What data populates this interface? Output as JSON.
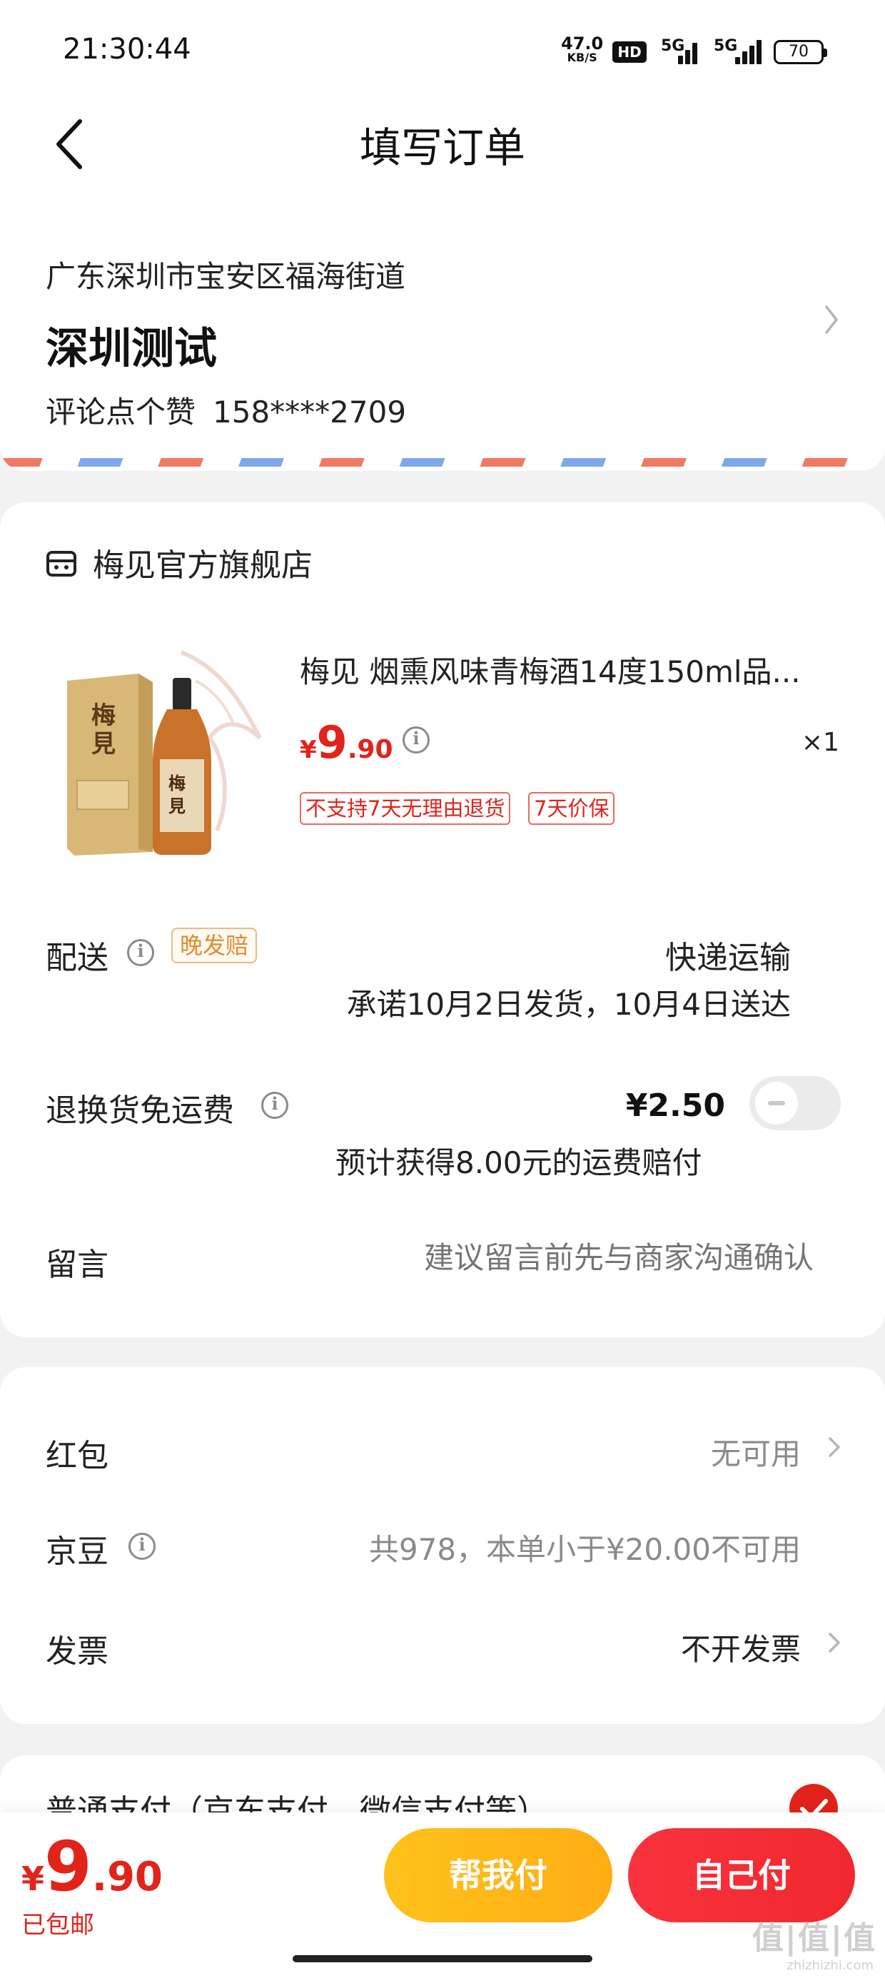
{
  "status_bar": {
    "time": "21:30:44",
    "net_speed": "47.0",
    "net_unit": "KB/S",
    "hd": "HD",
    "sig1": "5G",
    "sig2": "5G",
    "battery": "70"
  },
  "header": {
    "title": "填写订单"
  },
  "address": {
    "region": "广东深圳市宝安区福海街道",
    "name": "深圳测试",
    "contact_name": "评论点个赞",
    "phone": "158****2709"
  },
  "shop": {
    "name": "梅见官方旗舰店"
  },
  "product": {
    "title": "梅见 烟熏风味青梅酒14度150ml品...",
    "price_yen": "¥",
    "price_int": "9",
    "price_dec": ".90",
    "qty": "×1",
    "tags": [
      "不支持7天无理由退货",
      "7天价保"
    ],
    "image_icon": "liquor-bottle-with-box"
  },
  "delivery": {
    "label": "配送",
    "tag": "晚发赔",
    "mode": "快递运输",
    "promise": "承诺10月2日发货，10月4日送达"
  },
  "return_shipping": {
    "label": "退换货免运费",
    "price": "¥2.50",
    "compensate": "预计获得8.00元的运费赔付",
    "enabled": false
  },
  "message": {
    "label": "留言",
    "placeholder": "建议留言前先与商家沟通确认"
  },
  "benefits": {
    "red_packet_label": "红包",
    "red_packet_value": "无可用",
    "jd_beans_label": "京豆",
    "jd_beans_value": "共978，本单小于¥20.00不可用",
    "invoice_label": "发票",
    "invoice_value": "不开发票"
  },
  "payment": {
    "option_label": "普通支付（京东支付、微信支付等）",
    "selected": true
  },
  "bottom": {
    "total_yen": "¥",
    "total_int": "9",
    "total_dec": ".90",
    "free_shipping": "已包邮",
    "help_pay": "帮我付",
    "self_pay": "自己付"
  },
  "watermark": {
    "main": "值|值|值",
    "sub": "zhizhizhi.com"
  },
  "colors": {
    "accent_red": "#e2231a",
    "orange": "#ffb31a",
    "late_tag": "#e48a2e"
  }
}
